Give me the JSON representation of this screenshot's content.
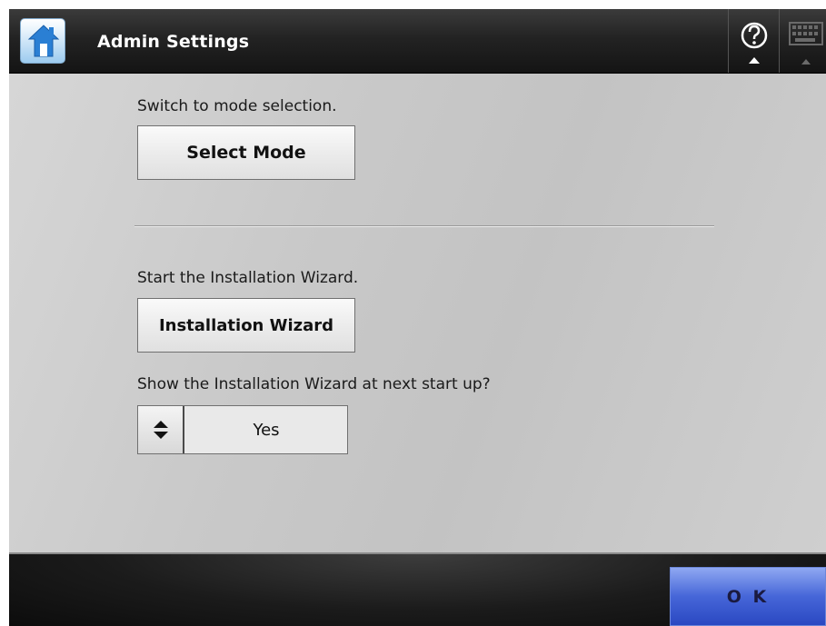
{
  "header": {
    "title": "Admin Settings",
    "home_icon": "home-icon",
    "help_icon": "help-icon",
    "keyboard_icon": "keyboard-icon"
  },
  "mode_section": {
    "description": "Switch to mode selection.",
    "button_label": "Select Mode"
  },
  "wizard_section": {
    "description": "Start the Installation Wizard.",
    "button_label": "Installation Wizard",
    "startup_question": "Show the Installation Wizard at next start up?",
    "startup_value": "Yes"
  },
  "footer": {
    "ok_label": "O K"
  },
  "colors": {
    "accent_blue": "#3f5fd6",
    "header_bg": "#232323",
    "content_bg": "#c8c8c8"
  }
}
